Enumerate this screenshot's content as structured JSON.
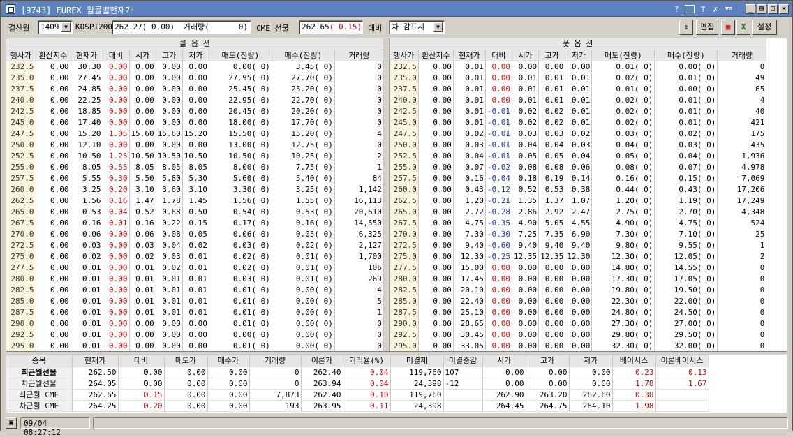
{
  "window": {
    "title": "[9743] EUREX 월물별현재가",
    "help": "?"
  },
  "toolbar": {
    "month_label": "결산월",
    "month_value": "1409",
    "kospi_label": "KOSPI200",
    "kospi_value": "262.27( 0.00)",
    "volume_label": "거래량(",
    "volume_value": "0)",
    "cme_label": "CME 선물",
    "cme_price": "262.65",
    "cme_change": "( 0.15)",
    "compare_label": "대비",
    "compare_value": "차 감표시",
    "edit_label": "편집",
    "settings_label": "설정"
  },
  "call_title": "콜 옵 션",
  "put_title": "풋 옵 션",
  "headers": [
    "행사가",
    "환산지수",
    "현재가",
    "대비",
    "시가",
    "고가",
    "저가",
    "매도(잔량)",
    "매수(잔량)",
    "거래량"
  ],
  "colors": {
    "up": "#e00000",
    "down": "#1030d0",
    "strike_bg": "#faf5dc"
  },
  "rows": [
    {
      "strike": "232.5",
      "call": [
        "0.00",
        "30.30",
        "0.00",
        "0.00",
        "0.00",
        "0.00",
        "0.00(      0)",
        "3.45(      0)",
        "0"
      ],
      "put": [
        "0.00",
        "0.01",
        "0.00",
        "0.00",
        "0.00",
        "0.00",
        "0.01(      0)",
        "0.00(      0)",
        "0"
      ]
    },
    {
      "strike": "235.0",
      "call": [
        "0.00",
        "27.45",
        "0.00",
        "0.00",
        "0.00",
        "0.00",
        "27.95(     0)",
        "27.70(     0)",
        "0"
      ],
      "put": [
        "0.00",
        "0.01",
        "0.00",
        "0.01",
        "0.01",
        "0.01",
        "0.02(      0)",
        "0.01(      0)",
        "49"
      ]
    },
    {
      "strike": "237.5",
      "call": [
        "0.00",
        "24.85",
        "0.00",
        "0.00",
        "0.00",
        "0.00",
        "25.45(     0)",
        "25.20(     0)",
        "0"
      ],
      "put": [
        "0.00",
        "0.01",
        "0.00",
        "0.01",
        "0.01",
        "0.01",
        "0.01(      0)",
        "0.00(      0)",
        "65"
      ]
    },
    {
      "strike": "240.0",
      "call": [
        "0.00",
        "22.25",
        "0.00",
        "0.00",
        "0.00",
        "0.00",
        "22.95(     0)",
        "22.70(     0)",
        "0"
      ],
      "put": [
        "0.00",
        "0.01",
        "0.00",
        "0.01",
        "0.01",
        "0.01",
        "0.02(      0)",
        "0.01(      0)",
        "4"
      ]
    },
    {
      "strike": "242.5",
      "call": [
        "0.00",
        "18.85",
        "0.00",
        "0.00",
        "0.00",
        "0.00",
        "20.45(     0)",
        "20.20(     0)",
        "0"
      ],
      "put": [
        "0.00",
        "0.01",
        "-0.01",
        "0.02",
        "0.02",
        "0.01",
        "0.02(      0)",
        "0.01(      0)",
        "40"
      ]
    },
    {
      "strike": "245.0",
      "call": [
        "0.00",
        "17.40",
        "0.00",
        "0.00",
        "0.00",
        "0.00",
        "18.00(     0)",
        "17.70(     0)",
        "0"
      ],
      "put": [
        "0.00",
        "0.01",
        "-0.01",
        "0.02",
        "0.02",
        "0.01",
        "0.02(      0)",
        "0.01(      0)",
        "421"
      ]
    },
    {
      "strike": "247.5",
      "call": [
        "0.00",
        "15.20",
        "1.05",
        "15.60",
        "15.60",
        "15.20",
        "15.50(     0)",
        "15.20(     0)",
        "4"
      ],
      "put": [
        "0.00",
        "0.02",
        "-0.01",
        "0.03",
        "0.03",
        "0.02",
        "0.03(      0)",
        "0.02(      0)",
        "175"
      ]
    },
    {
      "strike": "250.0",
      "call": [
        "0.00",
        "12.10",
        "0.00",
        "0.00",
        "0.00",
        "0.00",
        "13.00(     0)",
        "12.75(     0)",
        "0"
      ],
      "put": [
        "0.00",
        "0.03",
        "-0.01",
        "0.04",
        "0.04",
        "0.03",
        "0.04(      0)",
        "0.03(      0)",
        "435"
      ]
    },
    {
      "strike": "252.5",
      "call": [
        "0.00",
        "10.50",
        "1.25",
        "10.50",
        "10.50",
        "10.50",
        "10.50(     0)",
        "10.25(     0)",
        "2"
      ],
      "put": [
        "0.00",
        "0.04",
        "-0.01",
        "0.05",
        "0.05",
        "0.04",
        "0.05(      0)",
        "0.04(      0)",
        "1,936"
      ]
    },
    {
      "strike": "255.0",
      "call": [
        "0.00",
        "8.05",
        "0.55",
        "8.05",
        "8.05",
        "8.05",
        "8.00(      0)",
        "7.75(      0)",
        "1"
      ],
      "put": [
        "0.00",
        "0.07",
        "-0.02",
        "0.08",
        "0.08",
        "0.06",
        "0.08(      0)",
        "0.07(      0)",
        "4,978"
      ]
    },
    {
      "strike": "257.5",
      "call": [
        "0.00",
        "5.55",
        "0.30",
        "5.50",
        "5.80",
        "5.30",
        "5.60(      0)",
        "5.40(      0)",
        "84"
      ],
      "put": [
        "0.00",
        "0.16",
        "-0.04",
        "0.18",
        "0.19",
        "0.14",
        "0.16(      0)",
        "0.15(      0)",
        "7,069"
      ]
    },
    {
      "strike": "260.0",
      "call": [
        "0.00",
        "3.25",
        "0.20",
        "3.10",
        "3.60",
        "3.10",
        "3.30(      0)",
        "3.25(      0)",
        "1,142"
      ],
      "put": [
        "0.00",
        "0.43",
        "-0.12",
        "0.52",
        "0.53",
        "0.38",
        "0.44(      0)",
        "0.43(      0)",
        "17,206"
      ]
    },
    {
      "strike": "262.5",
      "call": [
        "0.00",
        "1.56",
        "0.16",
        "1.47",
        "1.78",
        "1.45",
        "1.56(      0)",
        "1.55(      0)",
        "16,113"
      ],
      "put": [
        "0.00",
        "1.20",
        "-0.21",
        "1.35",
        "1.37",
        "1.07",
        "1.20(      0)",
        "1.19(      0)",
        "17,249"
      ]
    },
    {
      "strike": "265.0",
      "call": [
        "0.00",
        "0.53",
        "0.04",
        "0.52",
        "0.68",
        "0.50",
        "0.54(      0)",
        "0.53(      0)",
        "20,610"
      ],
      "put": [
        "0.00",
        "2.72",
        "-0.28",
        "2.86",
        "2.92",
        "2.47",
        "2.75(      0)",
        "2.70(      0)",
        "4,348"
      ]
    },
    {
      "strike": "267.5",
      "call": [
        "0.00",
        "0.16",
        "0.01",
        "0.16",
        "0.22",
        "0.15",
        "0.17(      0)",
        "0.16(      0)",
        "14,550"
      ],
      "put": [
        "0.00",
        "4.75",
        "-0.35",
        "4.90",
        "5.05",
        "4.55",
        "4.90(      0)",
        "4.75(      0)",
        "524"
      ]
    },
    {
      "strike": "270.0",
      "call": [
        "0.00",
        "0.06",
        "0.00",
        "0.06",
        "0.08",
        "0.05",
        "0.06(      0)",
        "0.05(      0)",
        "6,325"
      ],
      "put": [
        "0.00",
        "7.30",
        "-0.30",
        "7.25",
        "7.35",
        "6.90",
        "7.30(      0)",
        "7.10(      0)",
        "25"
      ]
    },
    {
      "strike": "272.5",
      "call": [
        "0.00",
        "0.03",
        "0.00",
        "0.03",
        "0.04",
        "0.02",
        "0.03(      0)",
        "0.02(      0)",
        "2,127"
      ],
      "put": [
        "0.00",
        "9.40",
        "-0.60",
        "9.40",
        "9.40",
        "9.40",
        "9.80(      0)",
        "9.55(      0)",
        "1"
      ]
    },
    {
      "strike": "275.0",
      "call": [
        "0.00",
        "0.02",
        "0.00",
        "0.02",
        "0.03",
        "0.01",
        "0.02(      0)",
        "0.01(      0)",
        "1,700"
      ],
      "put": [
        "0.00",
        "12.30",
        "-0.25",
        "12.35",
        "12.35",
        "12.30",
        "12.30(     0)",
        "12.05(     0)",
        "2"
      ]
    },
    {
      "strike": "277.5",
      "call": [
        "0.00",
        "0.01",
        "0.00",
        "0.01",
        "0.02",
        "0.01",
        "0.02(      0)",
        "0.01(      0)",
        "106"
      ],
      "put": [
        "0.00",
        "15.00",
        "0.00",
        "0.00",
        "0.00",
        "0.00",
        "14.80(     0)",
        "14.55(     0)",
        "0"
      ]
    },
    {
      "strike": "280.0",
      "call": [
        "0.00",
        "0.01",
        "0.00",
        "0.01",
        "0.01",
        "0.01",
        "0.03(      0)",
        "0.01(      0)",
        "269"
      ],
      "put": [
        "0.00",
        "17.45",
        "0.00",
        "0.00",
        "0.00",
        "0.00",
        "17.30(     0)",
        "17.05(     0)",
        "0"
      ]
    },
    {
      "strike": "282.5",
      "call": [
        "0.00",
        "0.01",
        "0.00",
        "0.01",
        "0.01",
        "0.01",
        "0.01(      0)",
        "0.00(      0)",
        "4"
      ],
      "put": [
        "0.00",
        "20.10",
        "0.00",
        "0.00",
        "0.00",
        "0.00",
        "19.80(     0)",
        "19.50(     0)",
        "0"
      ]
    },
    {
      "strike": "285.0",
      "call": [
        "0.00",
        "0.01",
        "0.00",
        "0.01",
        "0.01",
        "0.01",
        "0.01(      0)",
        "0.00(      0)",
        "5"
      ],
      "put": [
        "0.00",
        "22.40",
        "0.00",
        "0.00",
        "0.00",
        "0.00",
        "22.30(     0)",
        "22.00(     0)",
        "0"
      ]
    },
    {
      "strike": "287.5",
      "call": [
        "0.00",
        "0.01",
        "0.00",
        "0.01",
        "0.01",
        "0.01",
        "0.01(      0)",
        "0.00(      0)",
        "1"
      ],
      "put": [
        "0.00",
        "25.10",
        "0.00",
        "0.00",
        "0.00",
        "0.00",
        "24.80(     0)",
        "24.50(     0)",
        "0"
      ]
    },
    {
      "strike": "290.0",
      "call": [
        "0.00",
        "0.01",
        "0.00",
        "0.00",
        "0.00",
        "0.00",
        "0.01(      0)",
        "0.00(      0)",
        "0"
      ],
      "put": [
        "0.00",
        "28.65",
        "0.00",
        "0.00",
        "0.00",
        "0.00",
        "27.30(     0)",
        "27.00(     0)",
        "0"
      ]
    },
    {
      "strike": "292.5",
      "call": [
        "0.00",
        "0.01",
        "0.00",
        "0.00",
        "0.00",
        "0.00",
        "0.00(      0)",
        "0.00(      0)",
        "0"
      ],
      "put": [
        "0.00",
        "30.45",
        "0.00",
        "0.00",
        "0.00",
        "0.00",
        "29.80(     0)",
        "29.50(     0)",
        "0"
      ]
    },
    {
      "strike": "295.0",
      "call": [
        "0.00",
        "0.01",
        "0.00",
        "0.00",
        "0.00",
        "0.00",
        "0.01(      0)",
        "0.00(      0)",
        "0"
      ],
      "put": [
        "0.00",
        "33.05",
        "0.00",
        "0.00",
        "0.00",
        "0.00",
        "32.30(     0)",
        "32.00(     0)",
        "0"
      ]
    }
  ],
  "summary": {
    "headers": [
      "종목",
      "현재가",
      "대비",
      "매도가",
      "매수가",
      "거래량",
      "이론가",
      "괴리율(%)",
      "미결제",
      "미결증감",
      "시가",
      "고가",
      "저가",
      "베이시스",
      "이론베이시스"
    ],
    "rows": [
      {
        "name": "최근월선물",
        "bold": true,
        "cells": [
          "262.50",
          "0.00",
          "0.00",
          "0.00",
          "0",
          "262.40",
          "0.04",
          "119,760",
          "107",
          "0.00",
          "0.00",
          "0.00",
          "0.23",
          "0.13"
        ]
      },
      {
        "name": "차근월선물",
        "bold": false,
        "cells": [
          "264.05",
          "0.00",
          "0.00",
          "0.00",
          "0",
          "263.94",
          "0.04",
          "24,398",
          "-12",
          "0.00",
          "0.00",
          "0.00",
          "1.78",
          "1.67"
        ]
      },
      {
        "name": "최근월 CME",
        "bold": false,
        "cells": [
          "262.65",
          "0.15",
          "0.00",
          "0.00",
          "7,873",
          "262.40",
          "0.10",
          "119,760",
          "",
          "262.90",
          "263.20",
          "262.60",
          "0.38",
          ""
        ]
      },
      {
        "name": "차근월 CME",
        "bold": false,
        "cells": [
          "264.25",
          "0.20",
          "0.00",
          "0.00",
          "193",
          "263.95",
          "0.11",
          "24,398",
          "",
          "264.45",
          "264.75",
          "264.10",
          "1.98",
          ""
        ]
      }
    ]
  },
  "status": {
    "time": "09/04 08:27:12"
  }
}
